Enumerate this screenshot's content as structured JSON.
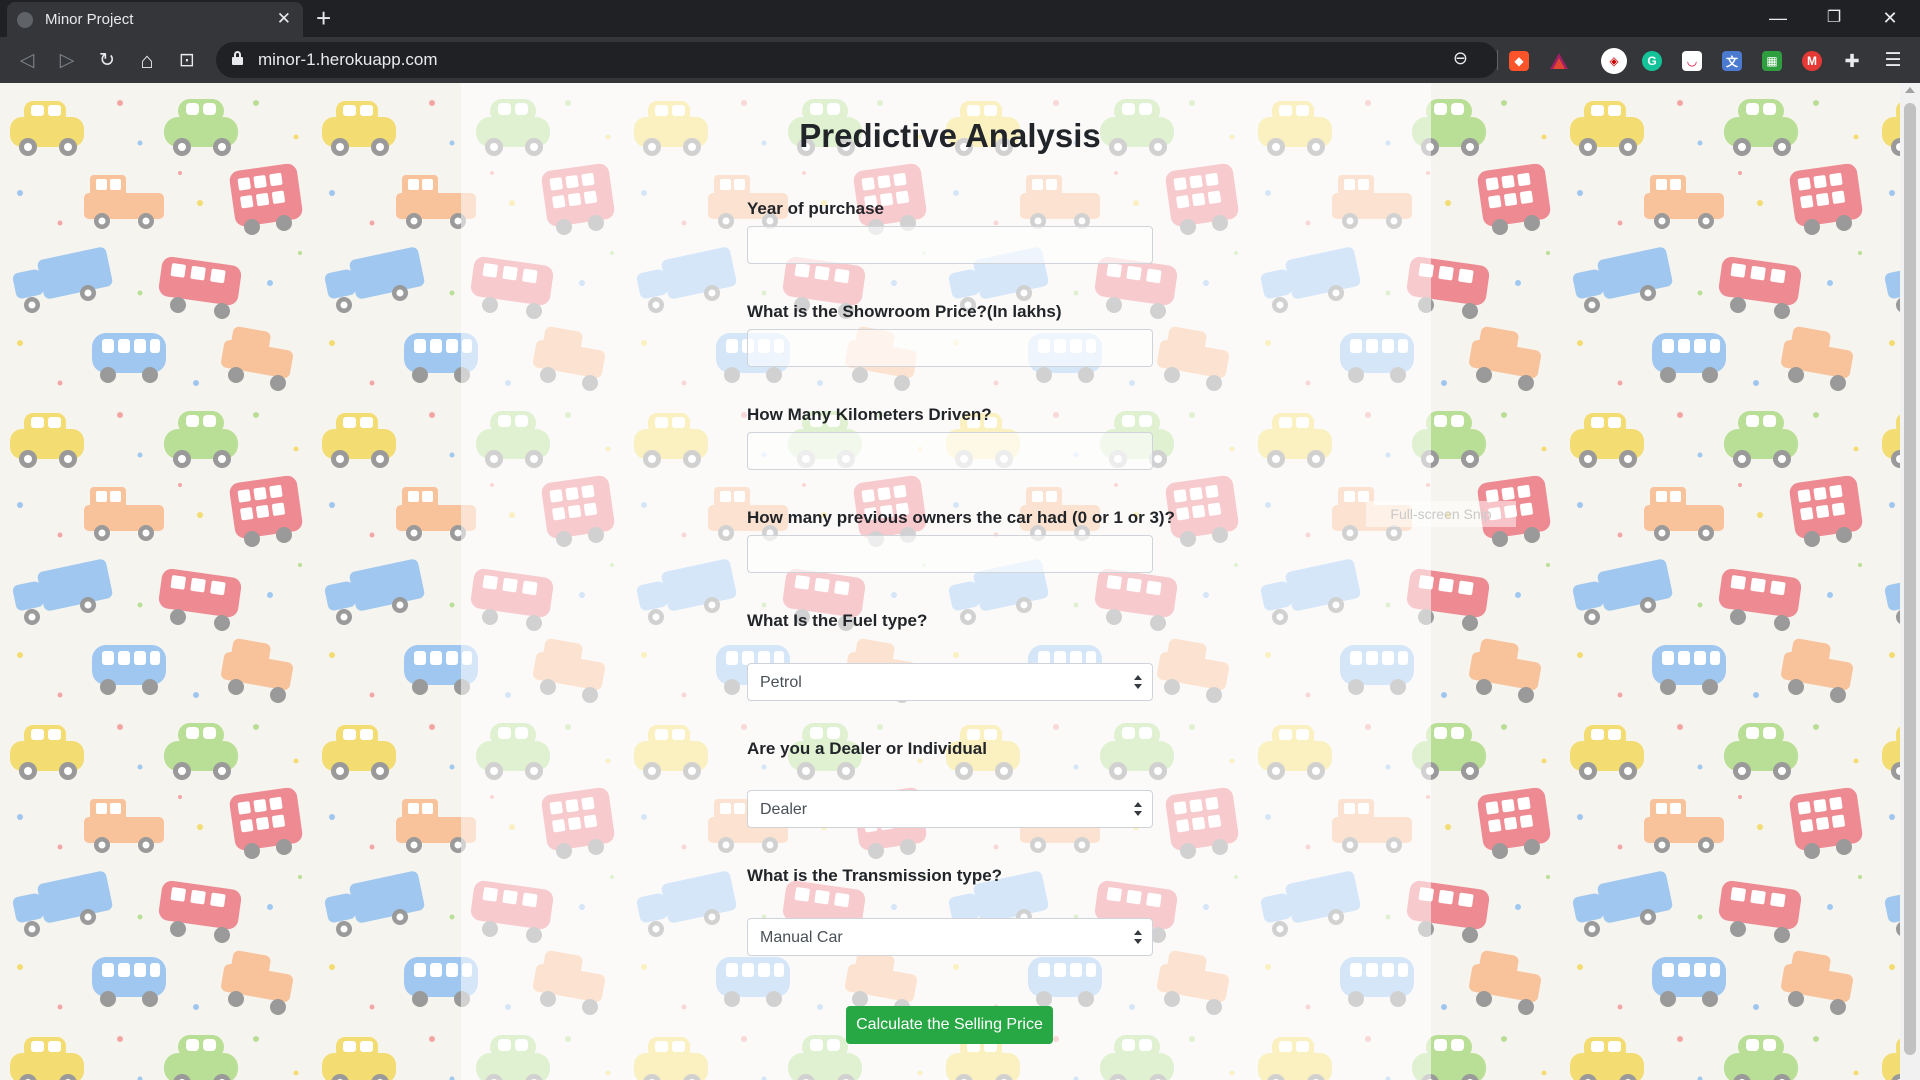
{
  "browser": {
    "tab_title": "Minor Project",
    "tab_close": "✕",
    "new_tab": "+",
    "url": "minor-1.herokuapp.com",
    "controls": {
      "minimize": "—",
      "restore": "❐",
      "close": "✕"
    },
    "nav": {
      "back": "◁",
      "forward": "▷",
      "reload": "↻",
      "home": "⌂",
      "bookmark": "⊡",
      "menu": "☰"
    },
    "zoom_icon": "⊖"
  },
  "page": {
    "title": "Predictive Analysis",
    "fields": [
      {
        "label": "Year of purchase",
        "value": ""
      },
      {
        "label": "What is the Showroom Price?(In lakhs)",
        "value": ""
      },
      {
        "label": "How Many Kilometers Driven?",
        "value": ""
      },
      {
        "label": "How many previous owners the car had (0 or 1 or 3)?",
        "value": ""
      }
    ],
    "selects": [
      {
        "label": "What Is the Fuel type?",
        "value": "Petrol"
      },
      {
        "label": "Are you a Dealer or Individual",
        "value": "Dealer"
      },
      {
        "label": "What is the Transmission type?",
        "value": "Manual Car"
      }
    ],
    "submit_label": "Calculate the Selling Price",
    "snip_overlay": "Full-screen Snip"
  },
  "colors": {
    "submit": "#28a745",
    "text": "#212529",
    "chrome_dark": "#202124",
    "chrome_toolbar": "#35363a"
  }
}
